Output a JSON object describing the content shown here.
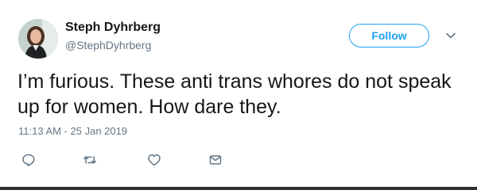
{
  "author": {
    "name": "Steph Dyhrberg",
    "handle": "@StephDyhrberg"
  },
  "follow_button": {
    "label": "Follow"
  },
  "tweet": {
    "text": "I’m furious. These anti trans whores do not speak up for women. How dare they.",
    "timestamp": "11:13 AM - 25 Jan 2019"
  },
  "icons": {
    "menu": "chevron-down-icon",
    "reply": "reply-icon",
    "retweet": "retweet-icon",
    "like": "heart-icon",
    "message": "envelope-icon"
  },
  "colors": {
    "accent": "#1da1f2",
    "secondary_text": "#657786",
    "primary_text": "#14171a"
  }
}
